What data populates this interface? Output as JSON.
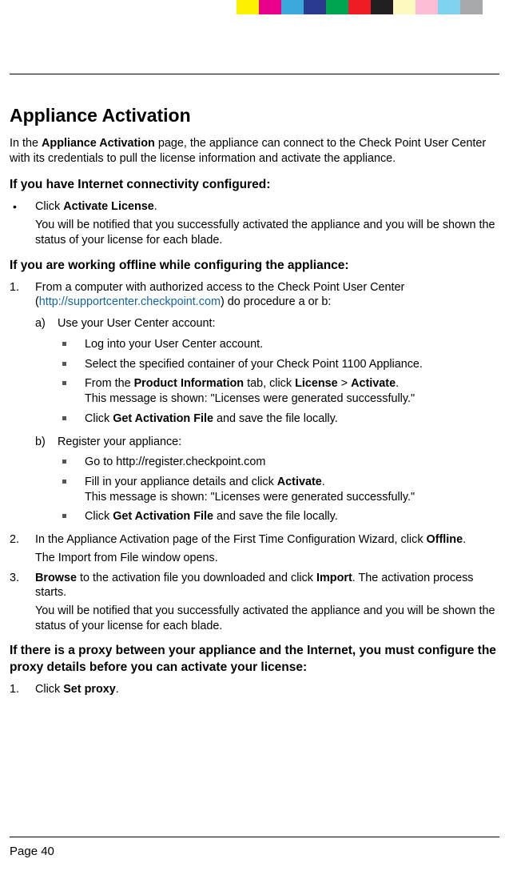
{
  "colorbar": [
    "#fef200",
    "#eb008b",
    "#3ca9dd",
    "#2a3a8f",
    "#00a551",
    "#ee1c25",
    "#231f20",
    "#fef9bf",
    "#febdd7",
    "#80d3ef",
    "#a7a9ac"
  ],
  "title": "Appliance Activation",
  "intro": {
    "pre": "In the ",
    "bold": "Appliance Activation",
    "post": " page, the appliance can connect to the Check Point User Center with its credentials to pull the license information and activate the appliance."
  },
  "section1": {
    "heading": "If you have Internet connectivity configured:",
    "bullet": {
      "pre": "Click ",
      "bold": "Activate License",
      "post": ".",
      "after": "You will be notified that you successfully activated the appliance and you will be shown the status of your license for each blade."
    }
  },
  "section2": {
    "heading": "If you are working offline while configuring the appliance:",
    "step1": {
      "pre": "From a computer with authorized access to the Check Point User Center (",
      "link": "http://supportcenter.checkpoint.com",
      "post": ") do procedure a or b:"
    },
    "optA": {
      "label": "Use your User Center account:",
      "b1": "Log into your User Center account.",
      "b2": "Select the specified container of your Check Point 1100 Appliance.",
      "b3": {
        "pre": "From the ",
        "bold1": "Product Information",
        "mid1": " tab, click  ",
        "bold2": "License",
        "mid2": " > ",
        "bold3": "Activate",
        "post": ".",
        "line2": "This message is shown: \"Licenses were generated successfully.\""
      },
      "b4": {
        "pre": "Click ",
        "bold": "Get Activation File",
        "post": " and save the file locally."
      }
    },
    "optB": {
      "label": "Register your appliance:",
      "b1": "Go to http://register.checkpoint.com",
      "b2": {
        "pre": "Fill in your appliance details and click ",
        "bold": "Activate",
        "post": ".",
        "line2": "This message is shown: \"Licenses were generated successfully.\""
      },
      "b3": {
        "pre": "Click ",
        "bold": "Get Activation File",
        "post": " and save the file locally."
      }
    },
    "step2": {
      "pre": "In the Appliance Activation page of the First Time Configuration Wizard, click ",
      "bold": "Offline",
      "post": ".",
      "after": "The Import from File window opens."
    },
    "step3": {
      "bold1": "Browse",
      "mid": " to the activation file you downloaded and click ",
      "bold2": "Import",
      "post": ". The activation process starts.",
      "after": "You will be notified that you successfully activated the appliance and you will be shown the status of your license for each blade."
    }
  },
  "section3": {
    "heading": "If there is a proxy between your appliance and the Internet, you must configure the proxy details before you can activate your license:",
    "step1": {
      "pre": "Click ",
      "bold": "Set proxy",
      "post": "."
    }
  },
  "page_number": "Page 40"
}
